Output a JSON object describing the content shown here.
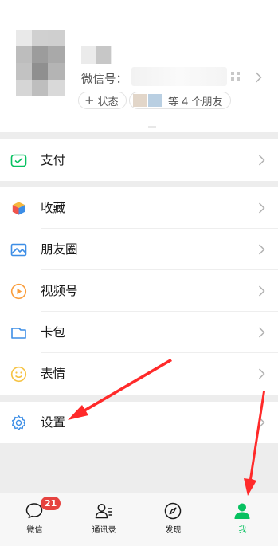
{
  "profile": {
    "wechat_id_label": "微信号：",
    "status_label": "状态",
    "friends_label": "等 4 个朋友"
  },
  "menu": {
    "pay": "支付",
    "favorites": "收藏",
    "moments": "朋友圈",
    "channels": "视频号",
    "cards": "卡包",
    "stickers": "表情",
    "settings": "设置"
  },
  "tabbar": {
    "chats": "微信",
    "chats_badge": "21",
    "contacts": "通讯录",
    "discover": "发现",
    "me": "我",
    "active": "我"
  },
  "colors": {
    "accent": "#07c160",
    "badge": "#e64340",
    "annotation_arrow": "#ff2a2a"
  }
}
